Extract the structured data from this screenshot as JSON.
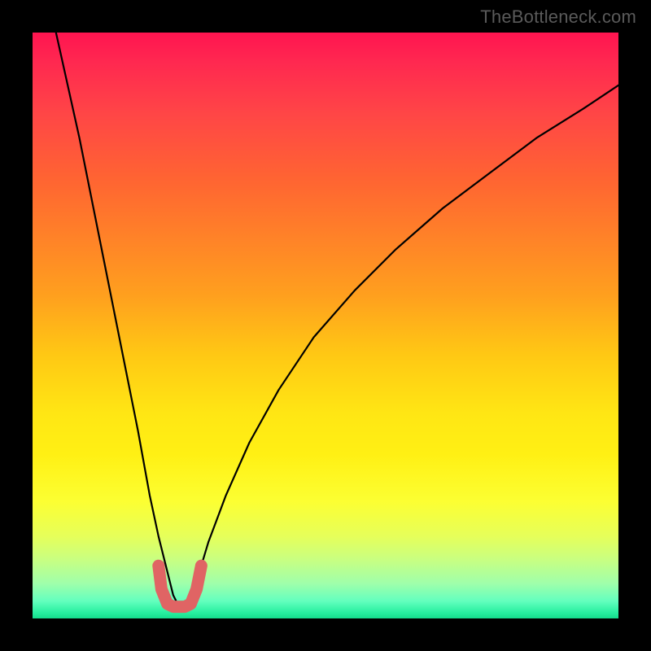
{
  "watermark": "TheBottleneck.com",
  "chart_data": {
    "type": "line",
    "title": "",
    "xlabel": "",
    "ylabel": "",
    "xlim": [
      0,
      100
    ],
    "ylim": [
      0,
      100
    ],
    "grid": false,
    "legend": false,
    "background_gradient": {
      "top_color": "#ff1450",
      "bottom_color": "#14dc8c",
      "note": "vertical gradient red→orange→yellow→green representing bottleneck severity; high y ≈ severe (red), low y ≈ balanced (green)"
    },
    "series": [
      {
        "name": "bottleneck-curve",
        "note": "V-shaped curve; x appears to represent relative hardware power ratio, y the bottleneck percentage. Values estimated from pixel positions; minimum (optimal balance point) near x≈25.",
        "x": [
          4,
          6,
          8,
          10,
          12,
          14,
          16,
          18,
          20,
          21.5,
          23,
          24,
          25,
          26,
          27,
          28.5,
          30,
          33,
          37,
          42,
          48,
          55,
          62,
          70,
          78,
          86,
          94,
          100
        ],
        "y": [
          100,
          91,
          82,
          72,
          62,
          52,
          42,
          32,
          21,
          14,
          8,
          4,
          2,
          2,
          4,
          8,
          13,
          21,
          30,
          39,
          48,
          56,
          63,
          70,
          76,
          82,
          87,
          91
        ]
      },
      {
        "name": "optimal-range-marker",
        "note": "Thick pink U-shaped marker at the valley bottom indicating the low-bottleneck region (approx x 21–29, y ≤ ~9).",
        "color": "#e06464",
        "x": [
          21.5,
          22,
          23,
          24,
          25,
          26,
          27,
          28,
          28.8
        ],
        "y": [
          9,
          5,
          2.5,
          2,
          2,
          2,
          2.5,
          5,
          9
        ]
      }
    ]
  }
}
